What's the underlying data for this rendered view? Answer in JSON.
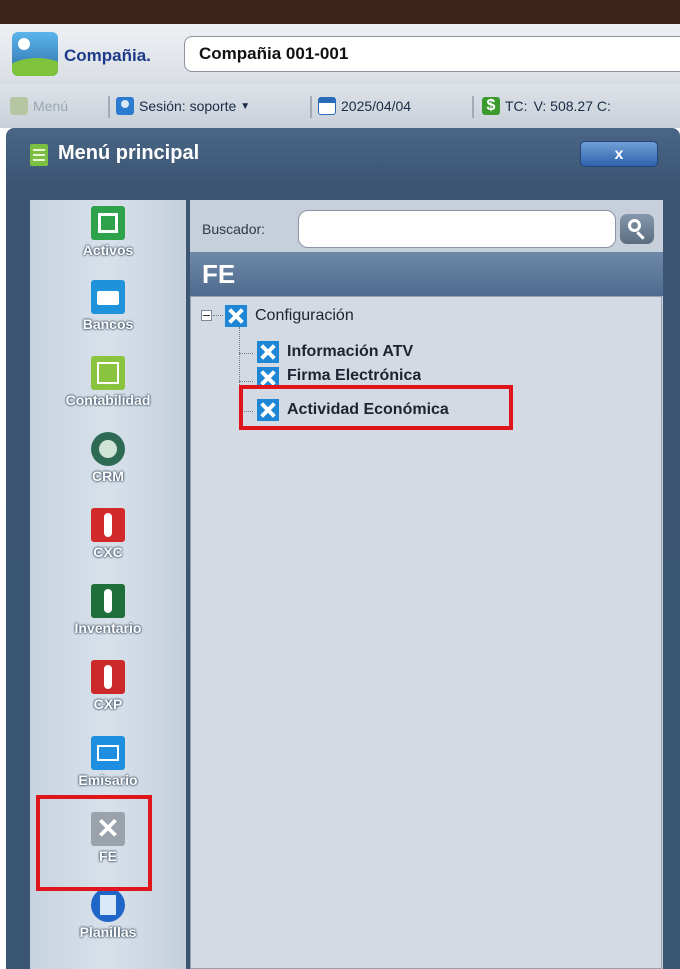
{
  "header": {
    "company_label": "Compañia.",
    "company_value": "Compañia 001-001"
  },
  "statusbar": {
    "menu_label": "Menú",
    "session_label": "Sesión: soporte",
    "date": "2025/04/04",
    "tc_label": "TC:",
    "tc_value": "V: 508.27 C:"
  },
  "menu_window": {
    "title": "Menú principal",
    "close_label": "x"
  },
  "sidebar": {
    "items": [
      {
        "label": "Activos",
        "icon": "cash-register-icon",
        "color": "#2ea24a"
      },
      {
        "label": "Bancos",
        "icon": "briefcase-icon",
        "color": "#1e93dc"
      },
      {
        "label": "Contabilidad",
        "icon": "chart-icon",
        "color": "#8ac43f"
      },
      {
        "label": "CRM",
        "icon": "globe-icon",
        "color": "#2f6a54"
      },
      {
        "label": "CXC",
        "icon": "person-collect-icon",
        "color": "#d4292a"
      },
      {
        "label": "Inventario",
        "icon": "person-box-icon",
        "color": "#1f6f3b"
      },
      {
        "label": "CXP",
        "icon": "person-pay-icon",
        "color": "#cc2a2a"
      },
      {
        "label": "Emisario",
        "icon": "envelope-icon",
        "color": "#1e8ee0"
      },
      {
        "label": "FE",
        "icon": "tools-icon",
        "color": "#9aa3ab"
      },
      {
        "label": "Planillas",
        "icon": "document-icon",
        "color": "#2066c8"
      }
    ]
  },
  "content": {
    "search_label": "Buscador:",
    "search_value": "",
    "section_title": "FE",
    "tree": {
      "root": "Configuración",
      "children": [
        "Información ATV",
        "Firma Electrónica",
        "Actividad Económica"
      ]
    }
  },
  "highlight_color": "#e0141b"
}
